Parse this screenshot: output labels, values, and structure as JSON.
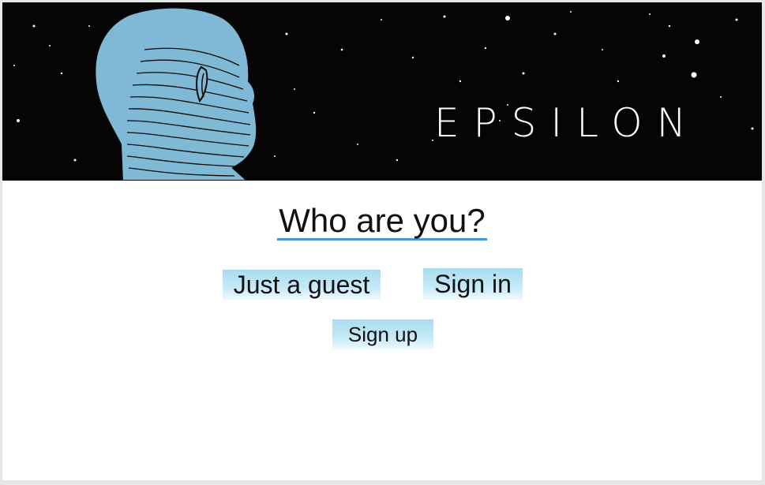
{
  "banner": {
    "logo_text": "EPSILON",
    "background_color": "#060405",
    "figure_color": "#7fb9d6",
    "illustration": "bald-head-profile-illustration"
  },
  "main": {
    "heading": "Who are you?",
    "underline_color": "#3d9ad9",
    "buttons": {
      "guest_label": "Just a guest",
      "signin_label": "Sign in",
      "signup_label": "Sign up"
    },
    "button_color": "#a9dcef"
  }
}
